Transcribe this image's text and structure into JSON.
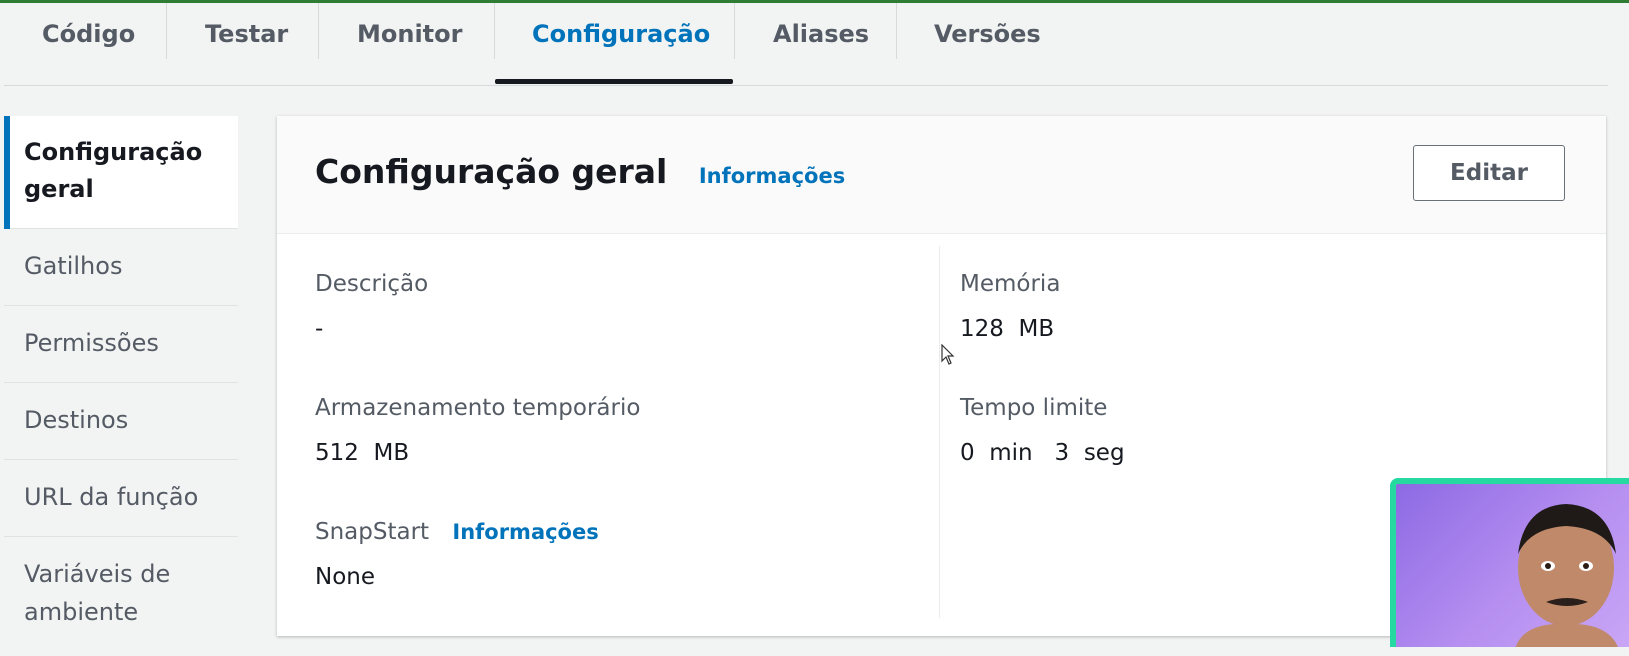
{
  "tabs": [
    {
      "label": "Código"
    },
    {
      "label": "Testar"
    },
    {
      "label": "Monitor"
    },
    {
      "label": "Configuração"
    },
    {
      "label": "Aliases"
    },
    {
      "label": "Versões"
    }
  ],
  "active_tab": "Configuração",
  "sidebar": {
    "items": [
      {
        "label_line1": "Configuração",
        "label_line2": "geral"
      },
      {
        "label": "Gatilhos"
      },
      {
        "label": "Permissões"
      },
      {
        "label": "Destinos"
      },
      {
        "label": "URL da função"
      },
      {
        "label_line1": "Variáveis de",
        "label_line2": "ambiente"
      }
    ]
  },
  "panel": {
    "title": "Configuração geral",
    "info_link": "Informações",
    "edit_label": "Editar",
    "fields": {
      "description": {
        "label": "Descrição",
        "value": "-"
      },
      "memory": {
        "label": "Memória",
        "value": "128  MB"
      },
      "ephemeral_storage": {
        "label": "Armazenamento temporário",
        "value": "512  MB"
      },
      "timeout": {
        "label": "Tempo limite",
        "value": "0  min   3  seg"
      },
      "snapstart": {
        "label": "SnapStart",
        "info_link": "Informações",
        "value": "None"
      }
    }
  },
  "colors": {
    "accent": "#0073bb",
    "top_line": "#2e7d32",
    "webcam_border": "#26d9a0"
  }
}
